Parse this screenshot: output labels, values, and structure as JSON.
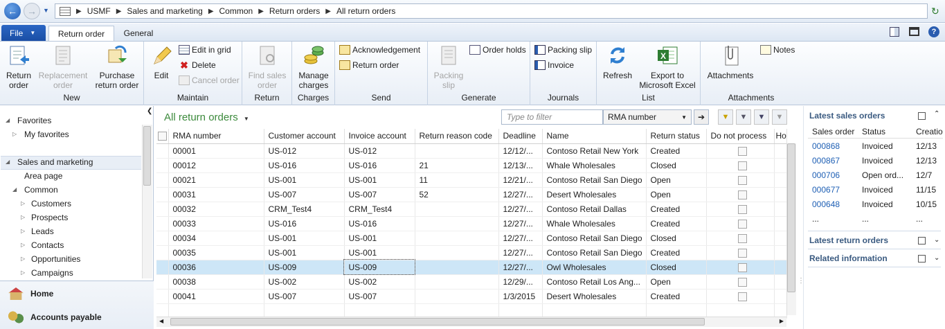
{
  "address": {
    "crumbs": [
      "USMF",
      "Sales and marketing",
      "Common",
      "Return orders",
      "All return orders"
    ]
  },
  "tabs": {
    "file": "File",
    "return_order": "Return order",
    "general": "General"
  },
  "ribbon": {
    "new": {
      "label": "New",
      "return_order": "Return\norder",
      "replacement_order": "Replacement\norder",
      "purchase_return_order": "Purchase\nreturn order"
    },
    "maintain": {
      "label": "Maintain",
      "edit": "Edit",
      "edit_in_grid": "Edit in grid",
      "delete": "Delete",
      "cancel_order": "Cancel order"
    },
    "return": {
      "label": "Return",
      "find_sales_order": "Find sales\norder"
    },
    "charges": {
      "label": "Charges",
      "manage_charges": "Manage\ncharges"
    },
    "send": {
      "label": "Send",
      "acknowledgement": "Acknowledgement",
      "return_order": "Return order"
    },
    "generate": {
      "label": "Generate",
      "packing_slip": "Packing\nslip",
      "order_holds": "Order holds"
    },
    "journals": {
      "label": "Journals",
      "packing_slip": "Packing slip",
      "invoice": "Invoice"
    },
    "list": {
      "label": "List",
      "refresh": "Refresh",
      "export": "Export to\nMicrosoft Excel"
    },
    "attachments": {
      "label": "Attachments",
      "attachments": "Attachments",
      "notes": "Notes"
    }
  },
  "nav": {
    "favorites": "Favorites",
    "my_favorites": "My favorites",
    "sales_and_marketing": "Sales and marketing",
    "area_page": "Area page",
    "common": "Common",
    "items": [
      "Customers",
      "Prospects",
      "Leads",
      "Contacts",
      "Opportunities",
      "Campaigns"
    ],
    "modules": [
      "Home",
      "Accounts payable"
    ]
  },
  "grid": {
    "title": "All return orders",
    "filter_placeholder": "Type to filter",
    "filter_field": "RMA number",
    "columns": [
      "RMA number",
      "Customer account",
      "Invoice account",
      "Return reason code",
      "Deadline",
      "Name",
      "Return status",
      "Do not process",
      "Ho"
    ],
    "rows": [
      [
        "00001",
        "US-012",
        "US-012",
        "",
        "12/12/...",
        "Contoso Retail New York",
        "Created"
      ],
      [
        "00012",
        "US-016",
        "US-016",
        "21",
        "12/13/...",
        "Whale Wholesales",
        "Closed"
      ],
      [
        "00021",
        "US-001",
        "US-001",
        "11",
        "12/21/...",
        "Contoso Retail San Diego",
        "Open"
      ],
      [
        "00031",
        "US-007",
        "US-007",
        "52",
        "12/27/...",
        "Desert Wholesales",
        "Open"
      ],
      [
        "00032",
        "CRM_Test4",
        "CRM_Test4",
        "",
        "12/27/...",
        "Contoso Retail Dallas",
        "Created"
      ],
      [
        "00033",
        "US-016",
        "US-016",
        "",
        "12/27/...",
        "Whale Wholesales",
        "Created"
      ],
      [
        "00034",
        "US-001",
        "US-001",
        "",
        "12/27/...",
        "Contoso Retail San Diego",
        "Closed"
      ],
      [
        "00035",
        "US-001",
        "US-001",
        "",
        "12/27/...",
        "Contoso Retail San Diego",
        "Created"
      ],
      [
        "00036",
        "US-009",
        "US-009",
        "",
        "12/27/...",
        "Owl Wholesales",
        "Closed"
      ],
      [
        "00038",
        "US-002",
        "US-002",
        "",
        "12/29/...",
        "Contoso Retail Los Ang...",
        "Open"
      ],
      [
        "00041",
        "US-007",
        "US-007",
        "",
        "1/3/2015",
        "Desert Wholesales",
        "Created"
      ]
    ],
    "selected_row": 8
  },
  "right": {
    "latest_sales_orders": "Latest sales orders",
    "cols": [
      "Sales order",
      "Status",
      "Creatio"
    ],
    "rows": [
      [
        "000868",
        "Invoiced",
        "12/13"
      ],
      [
        "000867",
        "Invoiced",
        "12/13"
      ],
      [
        "000706",
        "Open ord...",
        "12/7"
      ],
      [
        "000677",
        "Invoiced",
        "11/15"
      ],
      [
        "000648",
        "Invoiced",
        "10/15"
      ],
      [
        "...",
        "...",
        "..."
      ]
    ],
    "latest_return_orders": "Latest return orders",
    "related_information": "Related information"
  }
}
